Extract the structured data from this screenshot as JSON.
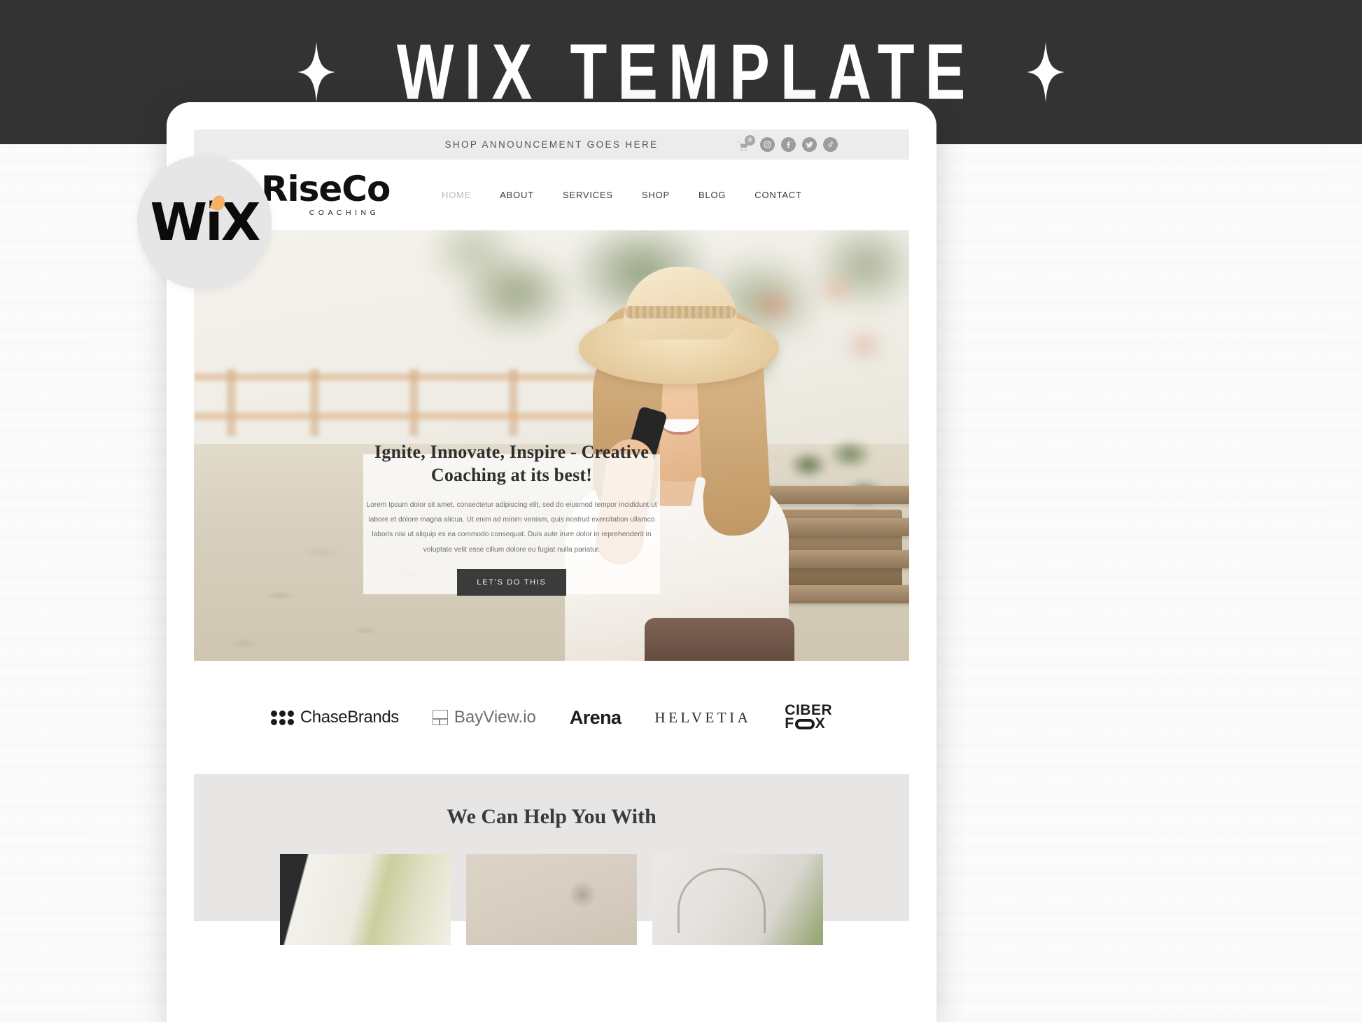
{
  "banner": {
    "title": "WIX TEMPLATE",
    "left_sparkle_icon": "sparkle-icon",
    "right_sparkle_icon": "sparkle-icon",
    "background_color": "#333333",
    "text_color": "#ffffff"
  },
  "wix_badge": {
    "label": "WiX",
    "accent_color": "#f5b267",
    "background_color": "#e6e6e6"
  },
  "site": {
    "announcement": {
      "text": "SHOP ANNOUNCEMENT GOES HERE",
      "cart_count": "0",
      "socials": [
        {
          "name": "cart-icon",
          "label": "Cart"
        },
        {
          "name": "instagram-icon",
          "label": "Instagram"
        },
        {
          "name": "facebook-icon",
          "label": "Facebook"
        },
        {
          "name": "twitter-icon",
          "label": "Twitter"
        },
        {
          "name": "tiktok-icon",
          "label": "TikTok"
        }
      ]
    },
    "logo": {
      "name": "RiseCo",
      "tagline": "COACHING"
    },
    "nav": [
      {
        "label": "HOME",
        "active": true
      },
      {
        "label": "ABOUT",
        "active": false
      },
      {
        "label": "SERVICES",
        "active": false
      },
      {
        "label": "SHOP",
        "active": false
      },
      {
        "label": "BLOG",
        "active": false
      },
      {
        "label": "CONTACT",
        "active": false
      }
    ],
    "hero": {
      "heading": "Ignite, Innovate, Inspire - Creative Coaching at its best!",
      "paragraph": "Lorem Ipsum dolor sit amet, consectetur adipiscing elit, sed do eiusmod tempor incididunt ut labore et dolore magna alicua. Ut enim ad minim veniam, quis nostrud exercitation ullamco laboris nisi ut aliquip ex ea commodo consequat. Duis aute irure dolor in reprehenderit in voluptate velit esse cillum dolore eu fugiat nulla pariatur.",
      "cta_label": "LET'S DO THIS",
      "cta_background": "#3b3b3b"
    },
    "brands": [
      {
        "name": "ChaseBrands",
        "icon": "dot-grid-icon"
      },
      {
        "name": "BayView.io",
        "icon": "square-window-icon"
      },
      {
        "name": "Arena",
        "icon": "triangle-a-icon"
      },
      {
        "name": "HELVETIA",
        "icon": "none"
      },
      {
        "name_line1": "CIBER",
        "name_line2": "FOX",
        "icon": "oval-o-icon"
      }
    ],
    "help_section": {
      "title": "We Can Help You With",
      "background_color": "#e8e6e4",
      "cards": [
        {
          "name": "help-card-1"
        },
        {
          "name": "help-card-2"
        },
        {
          "name": "help-card-3"
        }
      ]
    }
  }
}
